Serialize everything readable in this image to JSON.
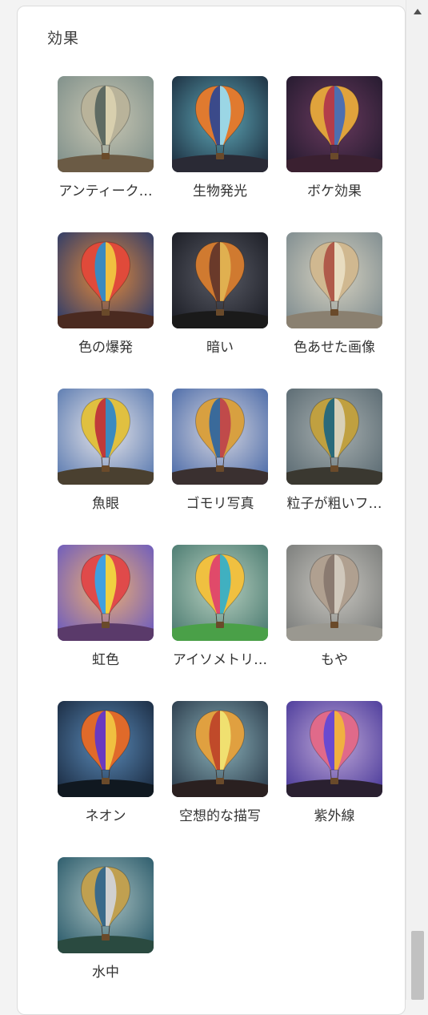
{
  "panel": {
    "title": "効果"
  },
  "effects": [
    {
      "label": "アンティーク…",
      "bg1": "#7e8f8a",
      "bg2": "#c9c7b3",
      "b1": "#b9b39a",
      "b2": "#5f6b63",
      "b3": "#d8cfae",
      "ground": "#6b5b45"
    },
    {
      "label": "生物発光",
      "bg1": "#1b2c3d",
      "bg2": "#5fa8b8",
      "b1": "#e07a2f",
      "b2": "#3b4a8a",
      "b3": "#9bd6e5",
      "ground": "#2a2a35"
    },
    {
      "label": "ボケ効果",
      "bg1": "#231a2e",
      "bg2": "#6a3a5e",
      "b1": "#e0a33c",
      "b2": "#b33d4a",
      "b3": "#4d6fb0",
      "ground": "#3a2030"
    },
    {
      "label": "色の爆発",
      "bg1": "#2a3a6a",
      "bg2": "#e58a3a",
      "b1": "#e04a3a",
      "b2": "#3a8ac0",
      "b3": "#f0c040",
      "ground": "#4a2a20"
    },
    {
      "label": "暗い",
      "bg1": "#1a1c24",
      "bg2": "#5a5c66",
      "b1": "#d07a30",
      "b2": "#6a3a2a",
      "b3": "#e0b050",
      "ground": "#1a1a1a"
    },
    {
      "label": "色あせた画像",
      "bg1": "#7d8b8f",
      "bg2": "#d8d3c1",
      "b1": "#d0b890",
      "b2": "#b05a4a",
      "b3": "#e8dcc0",
      "ground": "#8a8070"
    },
    {
      "label": "魚眼",
      "bg1": "#5a7ab0",
      "bg2": "#e8e6ea",
      "b1": "#e0c040",
      "b2": "#c03a3a",
      "b3": "#3a8ac0",
      "ground": "#4a4030"
    },
    {
      "label": "ゴモリ写真",
      "bg1": "#4a6aa8",
      "bg2": "#d6d6e0",
      "b1": "#d8a040",
      "b2": "#3a6a9a",
      "b3": "#c04a4a",
      "ground": "#3a3030"
    },
    {
      "label": "粒子が粗いフ…",
      "bg1": "#5a6a72",
      "bg2": "#a8b0b0",
      "b1": "#c0a040",
      "b2": "#2a6a7a",
      "b3": "#d8d0b8",
      "ground": "#3a3830"
    },
    {
      "label": "虹色",
      "bg1": "#6a5ac0",
      "bg2": "#f0b070",
      "b1": "#e04a4a",
      "b2": "#40a0e0",
      "b3": "#f0d040",
      "ground": "#5a3a6a"
    },
    {
      "label": "アイソメトリ…",
      "bg1": "#4a7a70",
      "bg2": "#b8d0c0",
      "b1": "#f0c040",
      "b2": "#e04a6a",
      "b3": "#40b0c0",
      "ground": "#4aa048"
    },
    {
      "label": "もや",
      "bg1": "#7a7c7a",
      "bg2": "#c8c6c0",
      "b1": "#b0a090",
      "b2": "#8a7a70",
      "b3": "#d0c8bc",
      "ground": "#9a9890"
    },
    {
      "label": "ネオン",
      "bg1": "#1a2a40",
      "bg2": "#5a8ab8",
      "b1": "#e06a2a",
      "b2": "#6a3ac0",
      "b3": "#f0c040",
      "ground": "#101820"
    },
    {
      "label": "空想的な描写",
      "bg1": "#2a3a4a",
      "bg2": "#8ab0b8",
      "b1": "#e0a040",
      "b2": "#c04a2a",
      "b3": "#f0e070",
      "ground": "#2a2020"
    },
    {
      "label": "紫外線",
      "bg1": "#4a3a9a",
      "bg2": "#c0a8d8",
      "b1": "#e06a8a",
      "b2": "#6a4ad0",
      "b3": "#f0b040",
      "ground": "#2a2030"
    },
    {
      "label": "水中",
      "bg1": "#2a5a6a",
      "bg2": "#a8c0c0",
      "b1": "#c0a050",
      "b2": "#3a6a8a",
      "b3": "#d0d0d0",
      "ground": "#2a4a40"
    }
  ]
}
